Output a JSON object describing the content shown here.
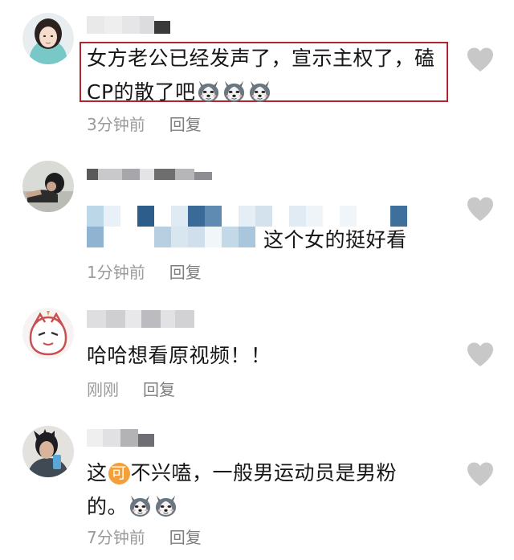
{
  "comments": [
    {
      "text_line1": "女方老公已经发声了，宣示主权了，磕",
      "text_line2": "CP的散了吧",
      "time": "3分钟前",
      "reply": "回复",
      "emoji_count": 3,
      "highlighted": true
    },
    {
      "text": "这个女的挺好看",
      "time": "1分钟前",
      "reply": "回复",
      "text_partially_mosaicked": true
    },
    {
      "text": "哈哈想看原视频！！",
      "time": "刚刚",
      "reply": "回复"
    },
    {
      "text_before_badge": "这",
      "badge": "可",
      "text_after_badge": "不兴嗑，一般男运动员是男粉",
      "text_line2": "的。",
      "time": "7分钟前",
      "reply": "回复",
      "emoji_count": 2
    }
  ],
  "colors": {
    "highlight_border": "#b32430",
    "meta_text": "#9a9a9a",
    "heart": "#c8c8c8",
    "badge": "#f4a03a"
  },
  "icons": {
    "like": "heart-icon",
    "emoji": "husky-emoji"
  }
}
